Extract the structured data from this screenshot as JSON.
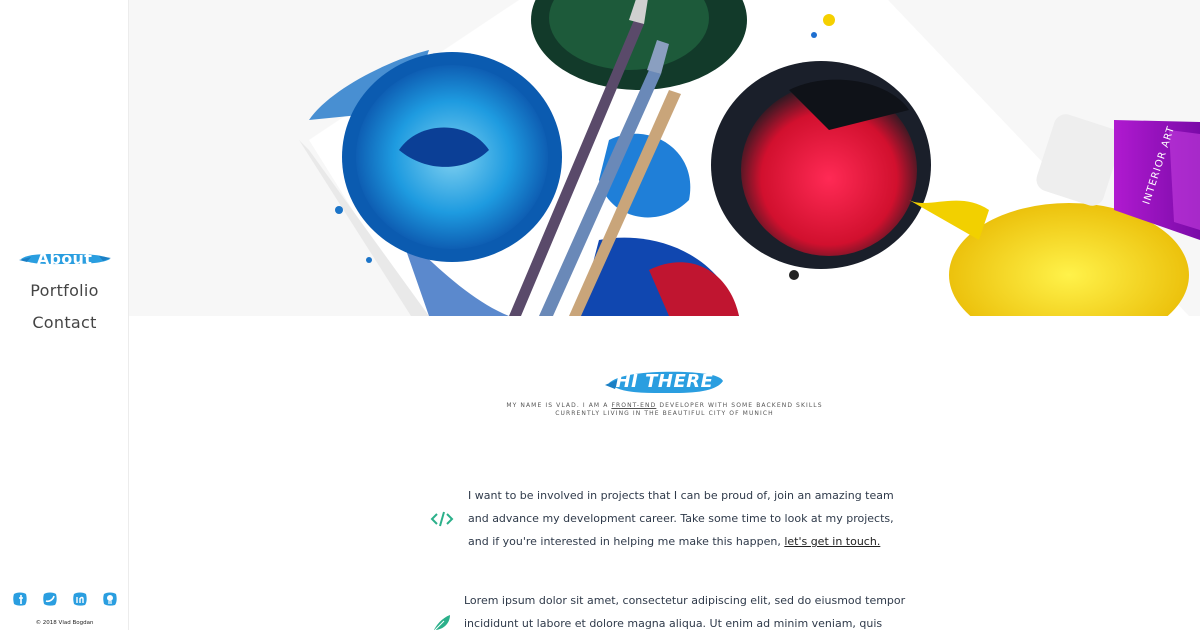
{
  "sidebar": {
    "nav": [
      {
        "label": "About",
        "active": true
      },
      {
        "label": "Portfolio",
        "active": false
      },
      {
        "label": "Contact",
        "active": false
      }
    ],
    "social_icons": [
      "facebook-icon",
      "twitter-icon",
      "linkedin-icon",
      "github-icon"
    ],
    "copyright": "© 2018 Vlad Bogdan"
  },
  "intro": {
    "title": "HI THERE",
    "tagline_part1": "MY NAME IS VLAD. I AM A ",
    "tagline_link": "FRONT-END",
    "tagline_part2": " DEVELOPER WITH SOME BACKEND SKILLS",
    "tagline_line2": "CURRENTLY LIVING IN THE BEAUTIFUL CITY OF MUNICH"
  },
  "blocks": [
    {
      "icon": "code-icon",
      "text": "I want to be involved in projects that I can be proud of, join an amazing team and advance my development career. Take some time to look at my projects, and if you're interested in helping me make this happen, ",
      "link": "let's get in touch."
    },
    {
      "icon": "feather-icon",
      "text": "Lorem ipsum dolor sit amet, consectetur adipiscing elit, sed do eiusmod tempor incididunt ut labore et dolore magna aliqua. Ut enim ad minim veniam, quis nostrud exercitation ullamco"
    }
  ],
  "colors": {
    "accent_blue": "#2a9ee0",
    "teal": "#2bb08a",
    "text": "#2f3a4a"
  }
}
